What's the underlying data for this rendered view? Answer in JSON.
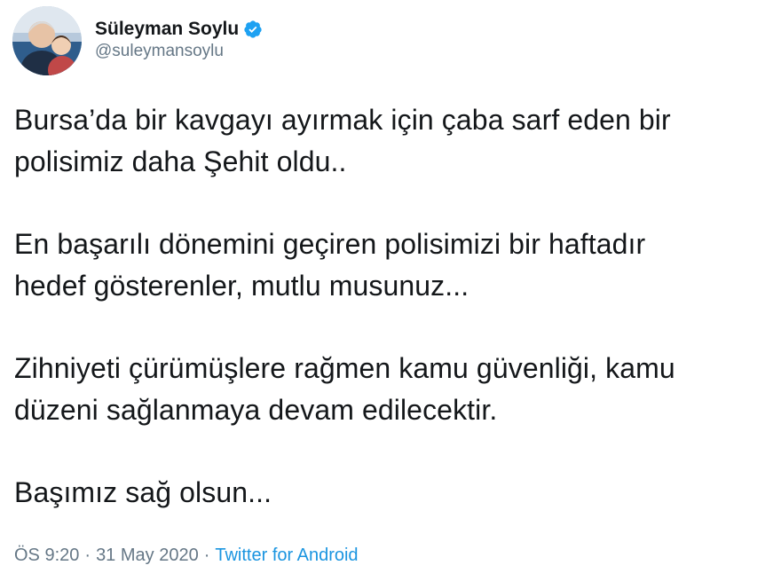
{
  "user": {
    "display_name": "Süleyman Soylu",
    "handle": "@suleymansoylu",
    "verified_icon": "verified-badge-icon",
    "verified_color": "#1da1f2"
  },
  "tweet": {
    "paragraphs": [
      "Bursa’da bir kavgayı ayırmak için çaba sarf eden bir\npolisimiz daha Şehit oldu..",
      "En başarılı dönemini geçiren polisimizi bir haftadır\nhedef gösterenler, mutlu musunuz...",
      "Zihniyeti çürümüşlere rağmen kamu güvenliği, kamu\ndüzeni sağlanmaya devam edilecektir.",
      "Başımız sağ olsun..."
    ]
  },
  "meta": {
    "time": "ÖS 9:20",
    "separator": "·",
    "date": "31 May 2020",
    "source": "Twitter for Android",
    "source_color": "#1b95e0"
  }
}
